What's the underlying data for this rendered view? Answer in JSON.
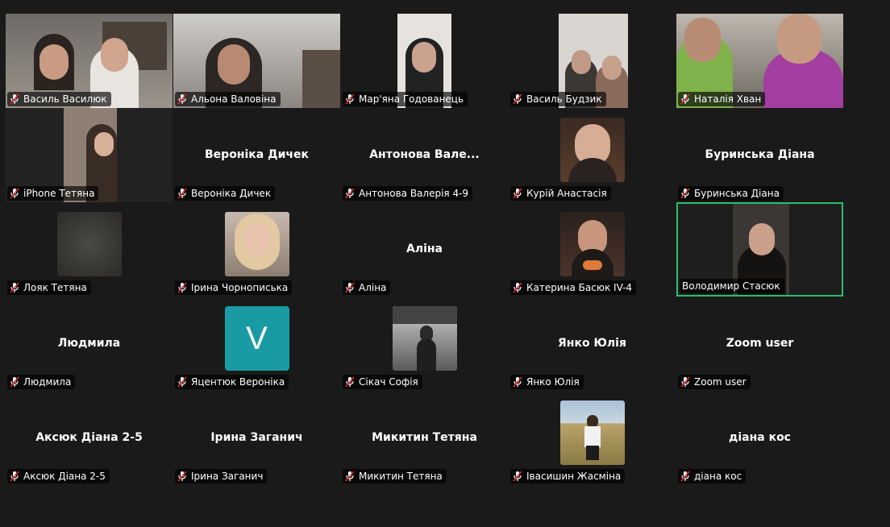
{
  "accent_speaking": "#2dbd6e",
  "avatar_color": "#1a9ba3",
  "participants": [
    {
      "name": "Василь Василюк",
      "kind": "video"
    },
    {
      "name": "Альона Валовіна",
      "kind": "video"
    },
    {
      "name": "Мар'яна Годованець",
      "kind": "video"
    },
    {
      "name": "Василь Будзик",
      "kind": "video"
    },
    {
      "name": "Наталія Хван",
      "kind": "video"
    },
    {
      "name": "iPhone Тетяна",
      "kind": "video"
    },
    {
      "name": "Вероніка  Дичек",
      "display": "Вероніка  Дичек",
      "kind": "name"
    },
    {
      "name": "Антонова Валерія 4-9",
      "display": "Антонова  Вале...",
      "kind": "name"
    },
    {
      "name": "Курій Анастасія",
      "kind": "thumb"
    },
    {
      "name": "Буринська Діана",
      "display": "Буринська Діана",
      "kind": "name"
    },
    {
      "name": "Лояк Тетяна",
      "kind": "thumb"
    },
    {
      "name": "Ірина Чорнописька",
      "kind": "thumb"
    },
    {
      "name": "Аліна",
      "display": "Аліна",
      "kind": "name"
    },
    {
      "name": "Катерина Басюк IV-4",
      "kind": "thumb"
    },
    {
      "name": "Володимир Стасюк",
      "kind": "speaking"
    },
    {
      "name": "Людмила",
      "display": "Людмила",
      "kind": "name"
    },
    {
      "name": "Яцентюк Вероніка",
      "avatar_letter": "V",
      "kind": "avatar"
    },
    {
      "name": "Сікач Софія",
      "kind": "thumb"
    },
    {
      "name": "Янко Юлія",
      "display": "Янко Юлія",
      "kind": "name"
    },
    {
      "name": "Zoom user",
      "display": "Zoom user",
      "kind": "name"
    },
    {
      "name": "Аксюк Діана 2-5",
      "display": "Аксюк Діана 2-5",
      "kind": "name"
    },
    {
      "name": "Ірина Заганич",
      "display": "Ірина Заганич",
      "kind": "name"
    },
    {
      "name": "Микитин Тетяна",
      "display": "Микитин Тетяна",
      "kind": "name"
    },
    {
      "name": "Івасишин Жасміна",
      "kind": "thumb"
    },
    {
      "name": "діана кос",
      "display": "діана кос",
      "kind": "name"
    }
  ]
}
